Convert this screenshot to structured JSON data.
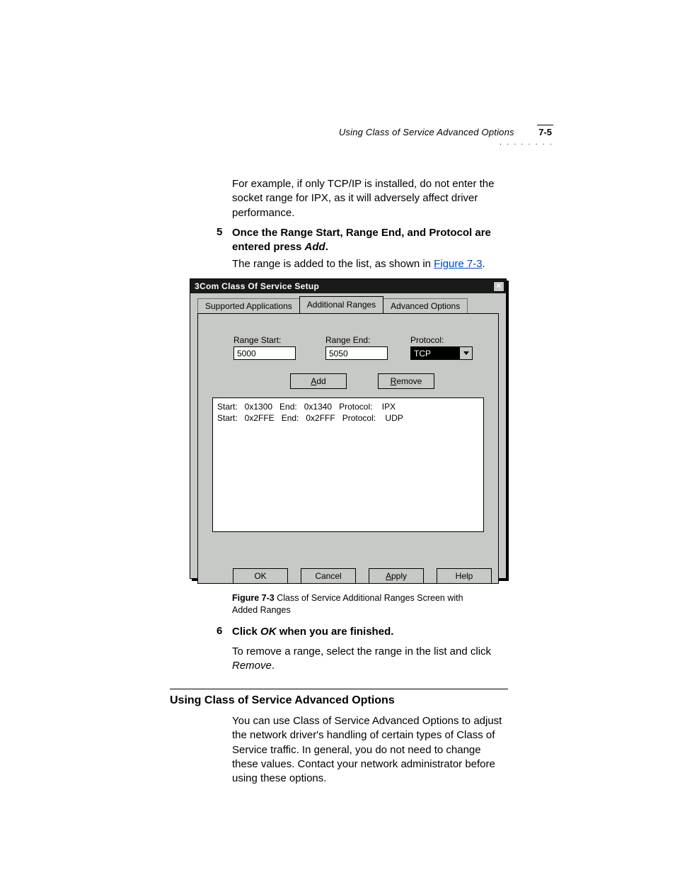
{
  "header": {
    "running_title": "Using Class of Service Advanced Options",
    "page_number": "7-5",
    "dots": "· · · · · · · ·"
  },
  "body": {
    "example_para": "For example, if only TCP/IP is installed, do not enter the socket range for IPX, as it will adversely affect driver performance.",
    "step5_num": "5",
    "step5_line1": "Once the Range Start, Range End, and Protocol are",
    "step5_line2_a": "entered press ",
    "step5_line2_em": "Add",
    "step5_line2_b": ".",
    "range_added_a": "The range is added to the list, as shown in ",
    "range_added_link": "Figure 7-3",
    "range_added_b": ".",
    "fig_label": "Figure 7-3",
    "fig_caption": "   Class of Service Additional Ranges Screen with Added Ranges",
    "step6_num": "6",
    "step6_a": "Click ",
    "step6_em": "OK",
    "step6_b": " when you are finished.",
    "remove_a": "To remove a range, select the range in the list and click ",
    "remove_em": "Remove",
    "remove_b": ".",
    "section_heading": "Using Class of Service Advanced Options",
    "adv_para": "You can use Class of Service Advanced Options to adjust the network driver's handling of certain types of Class of Service traffic. In general, you do not need to change these values. Contact your network administrator before using these options."
  },
  "dialog": {
    "title": "3Com Class Of Service Setup",
    "close": "×",
    "tabs": {
      "supported": "Supported Applications",
      "additional": "Additional Ranges",
      "advanced": "Advanced Options"
    },
    "labels": {
      "range_start": "Range Start:",
      "range_end": "Range End:",
      "protocol": "Protocol:"
    },
    "values": {
      "range_start": "5000",
      "range_end": "5050",
      "protocol": "TCP"
    },
    "buttons": {
      "add_pre": "",
      "add_u": "A",
      "add_post": "dd",
      "remove_pre": "",
      "remove_u": "R",
      "remove_post": "emove",
      "ok": "OK",
      "cancel": "Cancel",
      "apply_pre": "",
      "apply_u": "A",
      "apply_post": "pply",
      "help": "Help"
    },
    "list_text": "Start:   0x1300   End:   0x1340   Protocol:    IPX\nStart:   0x2FFE   End:   0x2FFF   Protocol:    UDP"
  }
}
